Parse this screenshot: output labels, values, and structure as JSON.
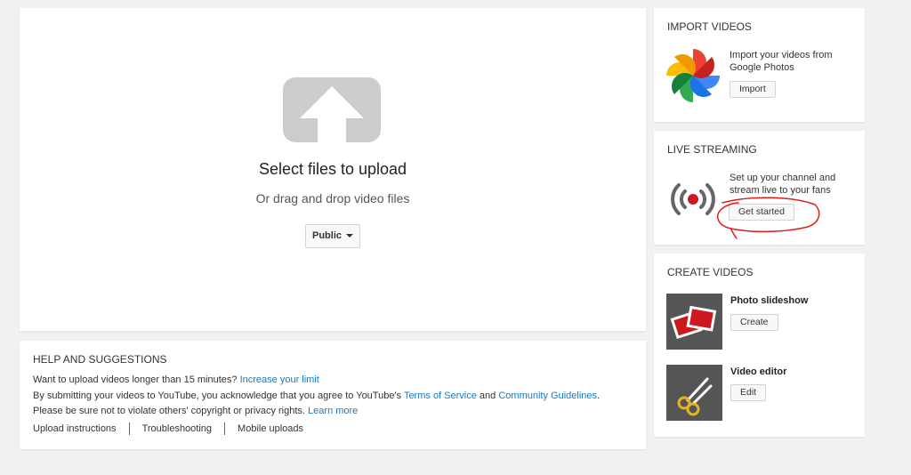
{
  "upload": {
    "title": "Select files to upload",
    "subtitle": "Or drag and drop video files",
    "privacy_value": "Public"
  },
  "help": {
    "title": "HELP AND SUGGESTIONS",
    "line1_text": "Want to upload videos longer than 15 minutes?",
    "line1_link": "Increase your limit",
    "line2_text": "By submitting your videos to YouTube, you acknowledge that you agree to YouTube's",
    "line2_link1": "Terms of Service",
    "line2_and": "and",
    "line2_link2": "Community Guidelines",
    "line2_end": ".",
    "line3_text": "Please be sure not to violate others' copyright or privacy rights.",
    "line3_link": "Learn more",
    "links": [
      "Upload instructions",
      "Troubleshooting",
      "Mobile uploads"
    ]
  },
  "import": {
    "title": "IMPORT VIDEOS",
    "text": "Import your videos from Google Photos",
    "button": "Import",
    "icon": "google-photos-icon"
  },
  "live": {
    "title": "LIVE STREAMING",
    "text": "Set up your channel and stream live to your fans",
    "button": "Get started",
    "icon": "live-broadcast-icon"
  },
  "create": {
    "title": "CREATE VIDEOS",
    "items": [
      {
        "label": "Photo slideshow",
        "button": "Create",
        "icon": "photo-slideshow-icon"
      },
      {
        "label": "Video editor",
        "button": "Edit",
        "icon": "scissors-icon"
      }
    ]
  },
  "colors": {
    "link": "#167ac6",
    "live_red": "#cc181e",
    "annotation": "#e31b1b",
    "thumb_bg": "#555555"
  }
}
